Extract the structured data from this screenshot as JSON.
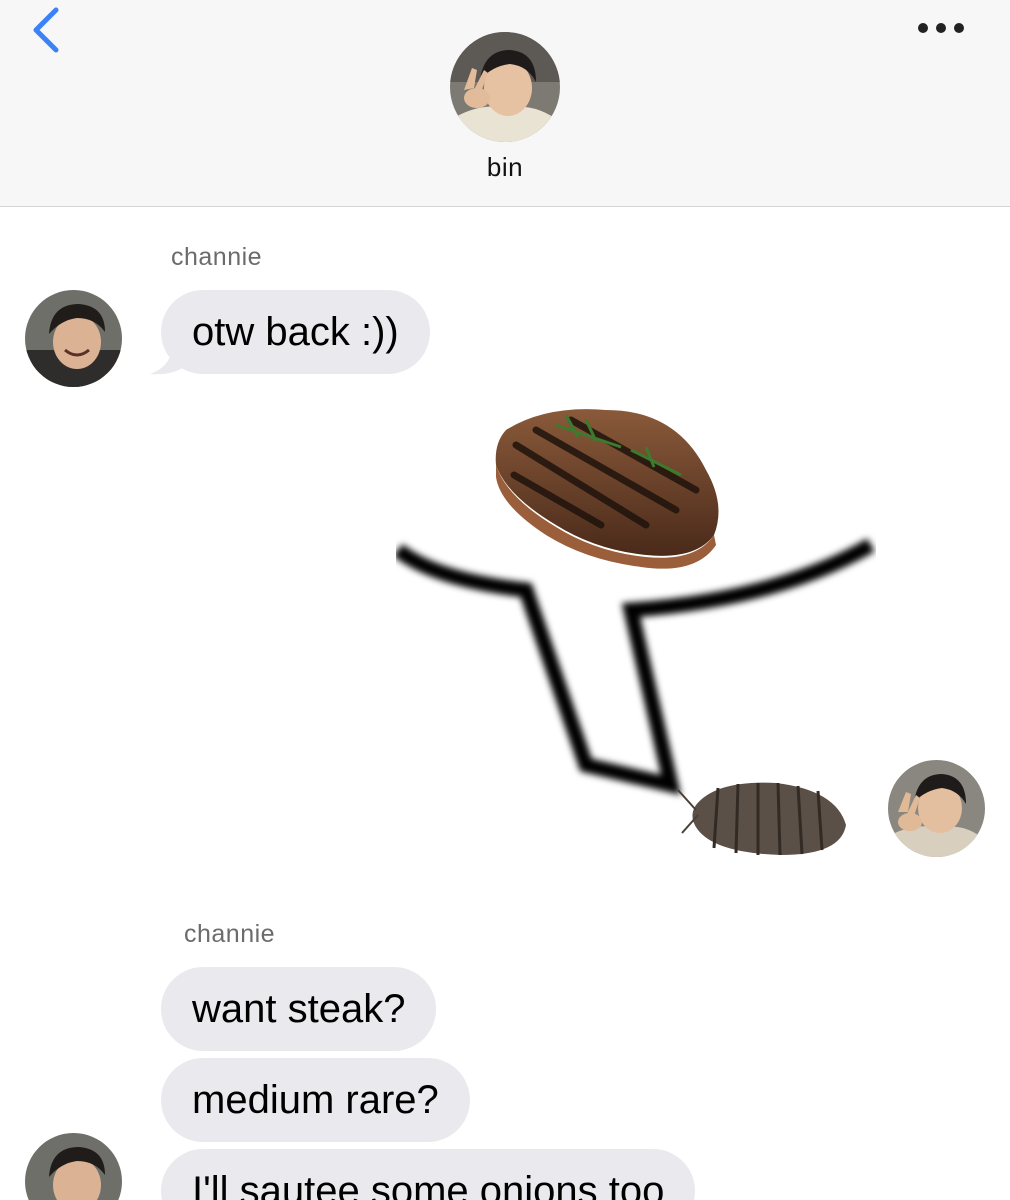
{
  "header": {
    "contact_name": "bin",
    "back_icon": "chevron-left-icon",
    "more_icon": "more-dots-icon"
  },
  "messages": [
    {
      "sender": "channie",
      "text": "otw back :))"
    },
    {
      "sender": "bin",
      "type": "sticker",
      "depicts": [
        "steak",
        "speech-bubble",
        "pill-bug"
      ]
    },
    {
      "sender": "channie",
      "texts": [
        "want steak?",
        "medium rare?",
        "I'll sautee some onions too"
      ]
    }
  ],
  "colors": {
    "header_bg": "#f7f7f7",
    "accent_blue": "#3b82f6",
    "incoming_bubble": "#e9e9ee",
    "sender_label": "#6b6b6b"
  }
}
